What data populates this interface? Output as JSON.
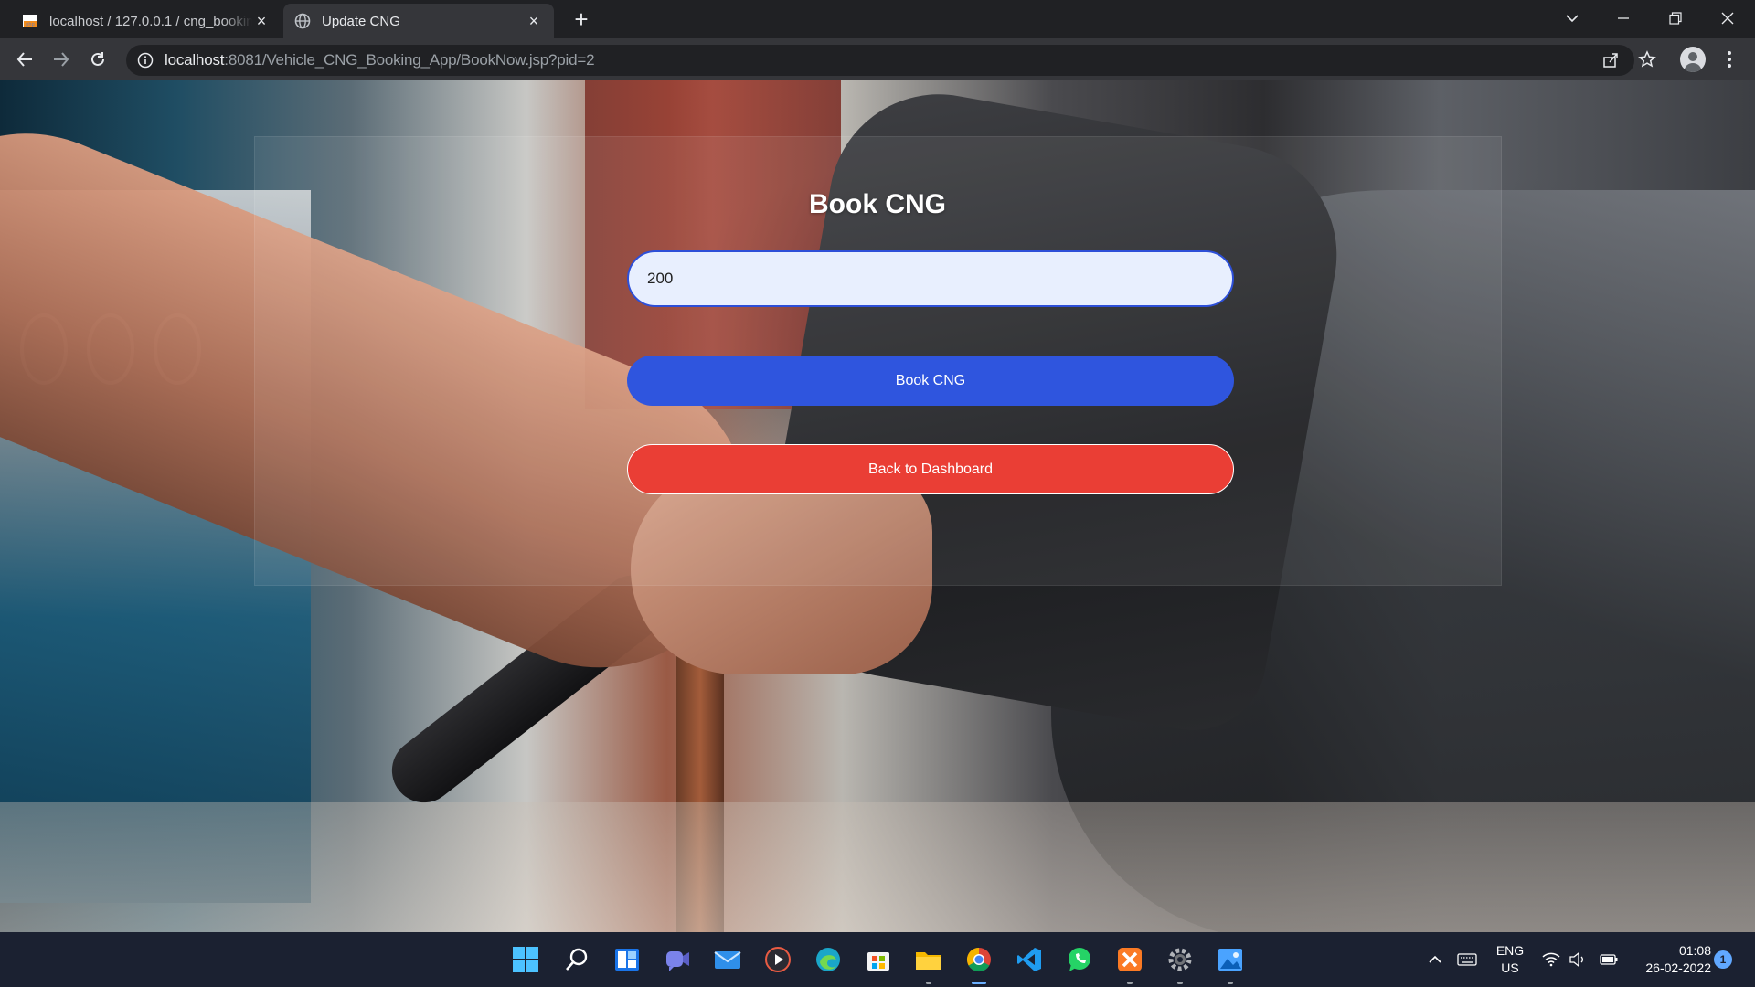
{
  "browser": {
    "tabs": [
      {
        "label": "localhost / 127.0.0.1 / cng_booking",
        "icon": "phpmyadmin-icon",
        "active": false
      },
      {
        "label": "Update CNG",
        "icon": "globe-icon",
        "active": true
      }
    ],
    "address": {
      "host": "localhost",
      "rest": ":8081/Vehicle_CNG_Booking_App/BookNow.jsp?pid=2"
    }
  },
  "page": {
    "title": "Book CNG",
    "quantity_value": "200",
    "book_button_label": "Book CNG",
    "back_button_label": "Back to Dashboard",
    "colors": {
      "primary_button": "#2f55de",
      "danger_button": "#ea3e35",
      "input_border": "#2d4fd8",
      "input_bg": "#e8effe"
    }
  },
  "taskbar": {
    "apps": [
      "windows-start-icon",
      "search-icon",
      "widgets-icon",
      "teams-chat-icon",
      "mail-icon",
      "media-player-icon",
      "edge-icon",
      "microsoft-store-icon",
      "file-explorer-icon",
      "chrome-icon",
      "vscode-icon",
      "whatsapp-icon",
      "xampp-icon",
      "settings-icon",
      "photos-icon"
    ],
    "language": {
      "line1": "ENG",
      "line2": "US"
    },
    "time": "01:08",
    "date": "26-02-2022",
    "notifications": "1"
  }
}
